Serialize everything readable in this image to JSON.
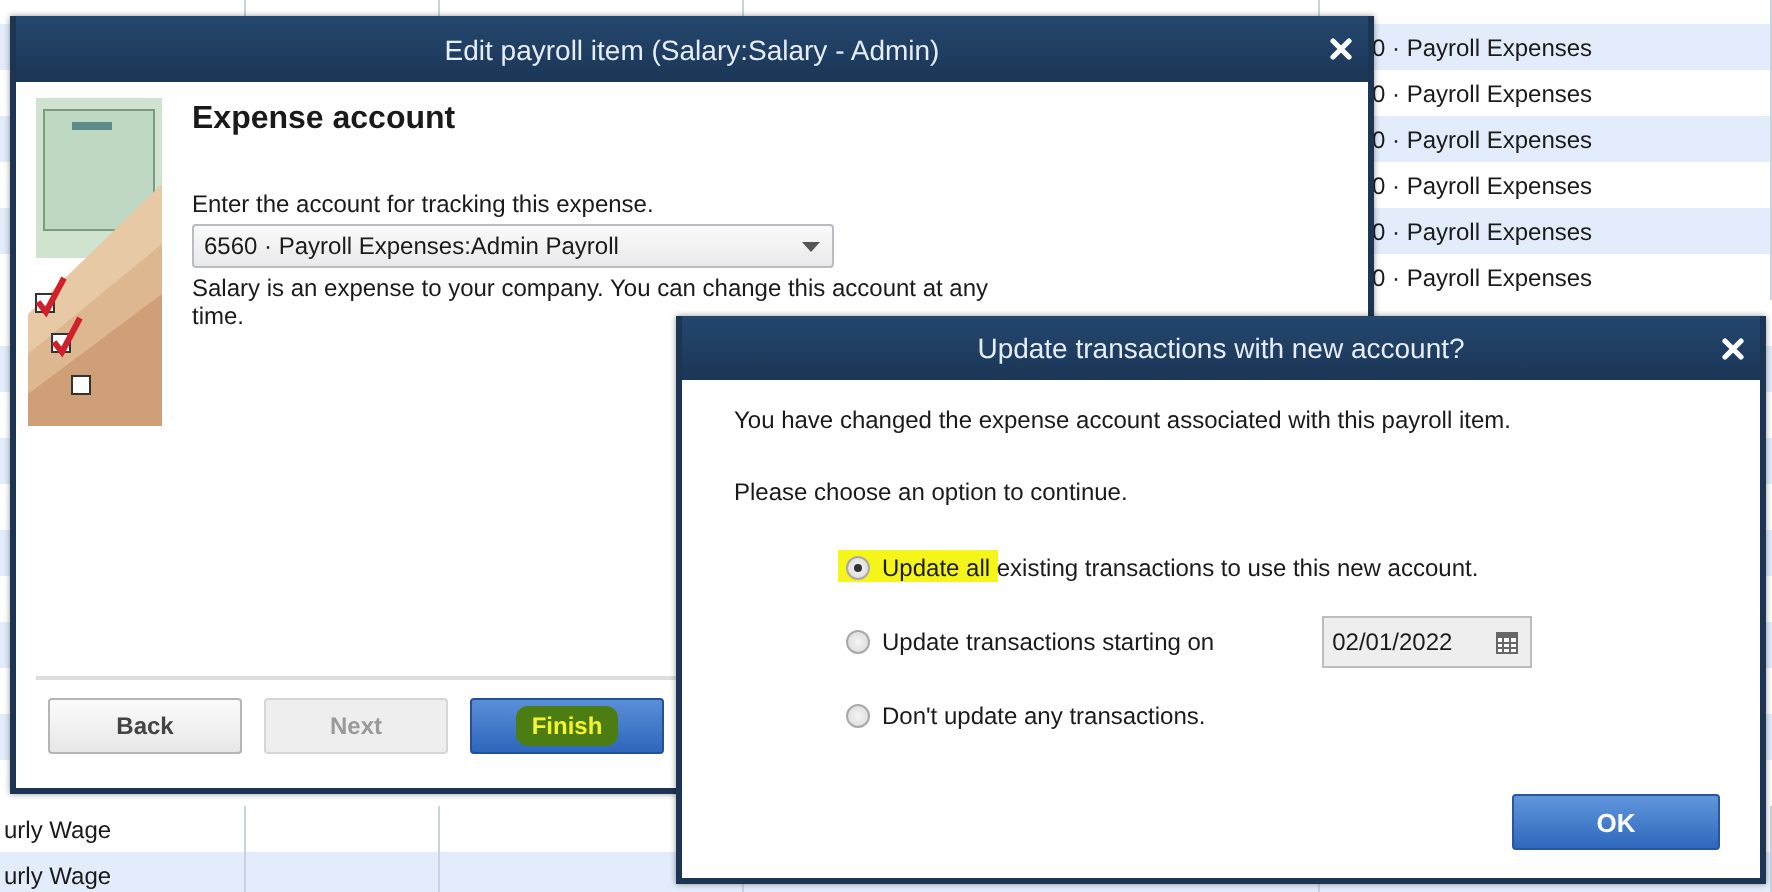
{
  "background_table": {
    "rows_top": [
      {
        "column_5": "0 · Payroll Expenses"
      },
      {
        "column_5": "0 · Payroll Expenses"
      },
      {
        "column_5": "0 · Payroll Expenses"
      },
      {
        "column_5": "0 · Payroll Expenses"
      },
      {
        "column_5": "0 · Payroll Expenses"
      },
      {
        "column_5": "0 · Payroll Expenses"
      }
    ],
    "rows_bottom": [
      {
        "column_1": "urly Wage"
      },
      {
        "column_1": "urly Wage"
      }
    ]
  },
  "edit_dialog": {
    "title": "Edit payroll item (Salary:Salary - Admin)",
    "heading": "Expense account",
    "prompt": "Enter the account for tracking this expense.",
    "account": {
      "value": "6560 · Payroll Expenses:Admin Payroll"
    },
    "note": "Salary is an expense to your company. You can change this account at any time.",
    "buttons": [
      {
        "label": "Back",
        "kind": "normal",
        "disabled": false,
        "highlighted": false
      },
      {
        "label": "Next",
        "kind": "normal",
        "disabled": true,
        "highlighted": false
      },
      {
        "label": "Finish",
        "kind": "primary",
        "disabled": false,
        "highlighted": true
      }
    ]
  },
  "update_dialog": {
    "title": "Update transactions with new account?",
    "message": "You have changed the expense account associated with this payroll item.",
    "prompt": "Please choose an option to continue.",
    "options": [
      {
        "label": "Update all existing transactions to use this new account.",
        "selected": true,
        "highlighted": true
      },
      {
        "label": "Update transactions starting on",
        "selected": false,
        "highlighted": false,
        "date": "02/01/2022"
      },
      {
        "label": "Don't update any transactions.",
        "selected": false,
        "highlighted": false
      }
    ],
    "ok_button": "OK"
  }
}
